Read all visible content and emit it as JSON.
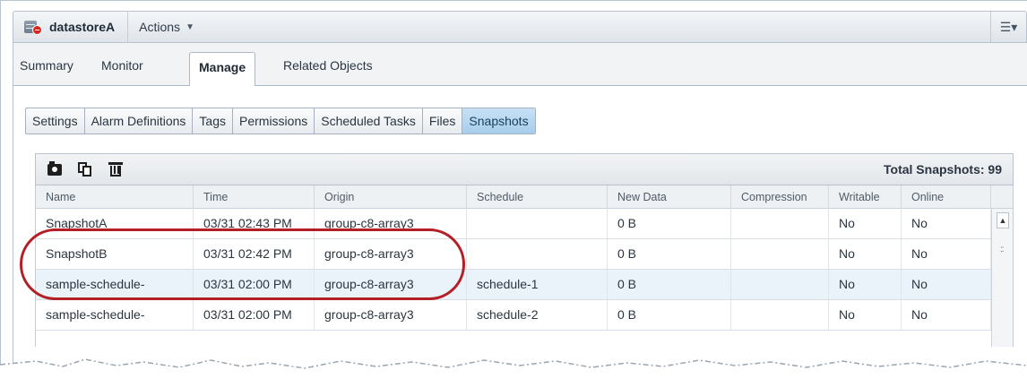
{
  "header": {
    "title": "datastoreA",
    "actions_label": "Actions",
    "menu_icon": "list-menu-icon"
  },
  "main_tabs": [
    {
      "label": "Summary",
      "active": false
    },
    {
      "label": "Monitor",
      "active": false
    },
    {
      "label": "Manage",
      "active": true
    },
    {
      "label": "Related Objects",
      "active": false
    }
  ],
  "sub_tabs": [
    {
      "label": "Settings",
      "active": false
    },
    {
      "label": "Alarm Definitions",
      "active": false
    },
    {
      "label": "Tags",
      "active": false
    },
    {
      "label": "Permissions",
      "active": false
    },
    {
      "label": "Scheduled Tasks",
      "active": false
    },
    {
      "label": "Files",
      "active": false
    },
    {
      "label": "Snapshots",
      "active": true
    }
  ],
  "toolbar": {
    "icons": [
      "camera-icon",
      "clone-icon",
      "trash-icon"
    ],
    "total_label": "Total Snapshots: 99"
  },
  "table": {
    "columns": [
      "Name",
      "Time",
      "Origin",
      "Schedule",
      "New Data",
      "Compression",
      "Writable",
      "Online"
    ],
    "rows": [
      [
        "SnapshotA",
        "03/31 02:43 PM",
        "group-c8-array3",
        "",
        "0 B",
        "",
        "No",
        "No"
      ],
      [
        "SnapshotB",
        "03/31 02:42 PM",
        "group-c8-array3",
        "",
        "0 B",
        "",
        "No",
        "No"
      ],
      [
        "sample-schedule-",
        "03/31 02:00 PM",
        "group-c8-array3",
        "schedule-1",
        "0 B",
        "",
        "No",
        "No"
      ],
      [
        "sample-schedule-",
        "03/31 02:00 PM",
        "group-c8-array3",
        "schedule-2",
        "0 B",
        "",
        "No",
        "No"
      ]
    ]
  },
  "colors": {
    "accent_tab": "#a7cdea",
    "highlight": "#b41f26",
    "alt_row": "#eaf2fa"
  }
}
